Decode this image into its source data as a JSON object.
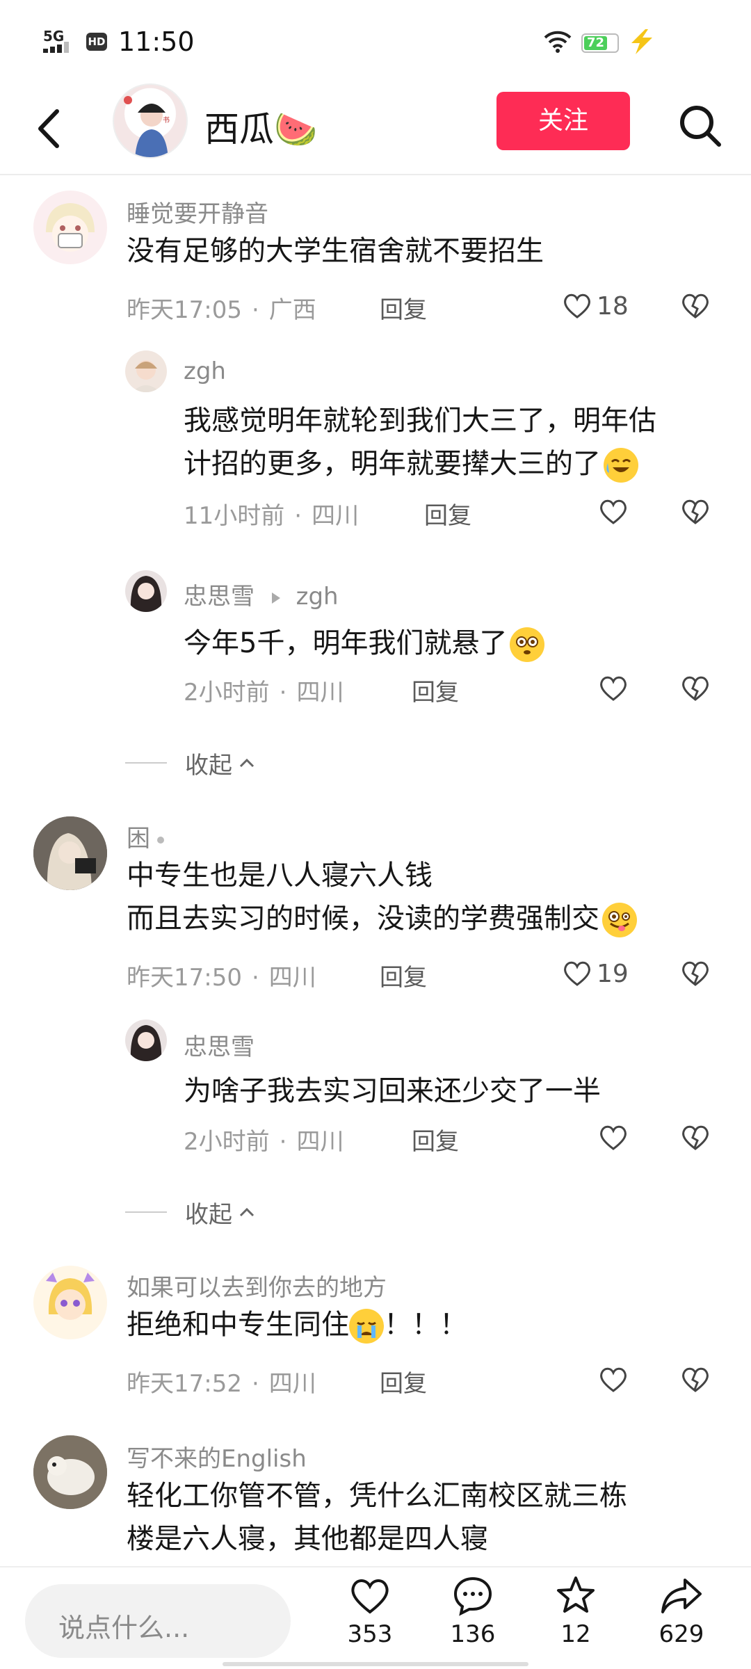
{
  "status": {
    "network": "5G",
    "hd": "HD",
    "time": "11:50",
    "battery": "72",
    "battery_level_pct": 72
  },
  "header": {
    "title": "西瓜🍉",
    "follow_label": "关注"
  },
  "comments": [
    {
      "name": "睡觉要开静音",
      "text": "没有足够的大学生宿舍就不要招生",
      "time": "昨天17:05",
      "location": "广西",
      "reply_label": "回复",
      "likes": "18"
    },
    {
      "name": "zgh",
      "text_line1": "我感觉明年就轮到我们大三了，明年估",
      "text_line2": "计招的更多，明年就要撵大三的了",
      "time": "11小时前",
      "location": "四川",
      "reply_label": "回复"
    },
    {
      "name": "忠思雪",
      "reply_to": "zgh",
      "text": "今年5千，明年我们就悬了",
      "time": "2小时前",
      "location": "四川",
      "reply_label": "回复"
    },
    {
      "name": "困",
      "text_line1": "中专生也是八人寝六人钱",
      "text_line2": "而且去实习的时候，没读的学费强制交",
      "time": "昨天17:50",
      "location": "四川",
      "reply_label": "回复",
      "likes": "19"
    },
    {
      "name": "忠思雪",
      "text": "为啥子我去实习回来还少交了一半",
      "time": "2小时前",
      "location": "四川",
      "reply_label": "回复"
    },
    {
      "name": "如果可以去到你去的地方",
      "text": "拒绝和中专生同住",
      "text_tail": "！！！",
      "time": "昨天17:52",
      "location": "四川",
      "reply_label": "回复"
    },
    {
      "name": "写不来的English",
      "text_line1": "轻化工你管不管，凭什么汇南校区就三栋",
      "text_line2": "楼是六人寝，其他都是四人寝"
    }
  ],
  "collapse_label": "收起",
  "meta_separator": "·",
  "bottom": {
    "input_placeholder": "说点什么...",
    "likes": "353",
    "comments": "136",
    "favorites": "12",
    "shares": "629"
  },
  "icons": {
    "back": "chevron-left-icon",
    "search": "search-icon",
    "like": "heart-icon",
    "dislike": "broken-heart-icon",
    "comment": "comment-bubble-icon",
    "favorite": "star-icon",
    "share": "share-arrow-icon"
  },
  "colors": {
    "accent": "#fe2c55",
    "muted_text": "#8a8a8a"
  }
}
